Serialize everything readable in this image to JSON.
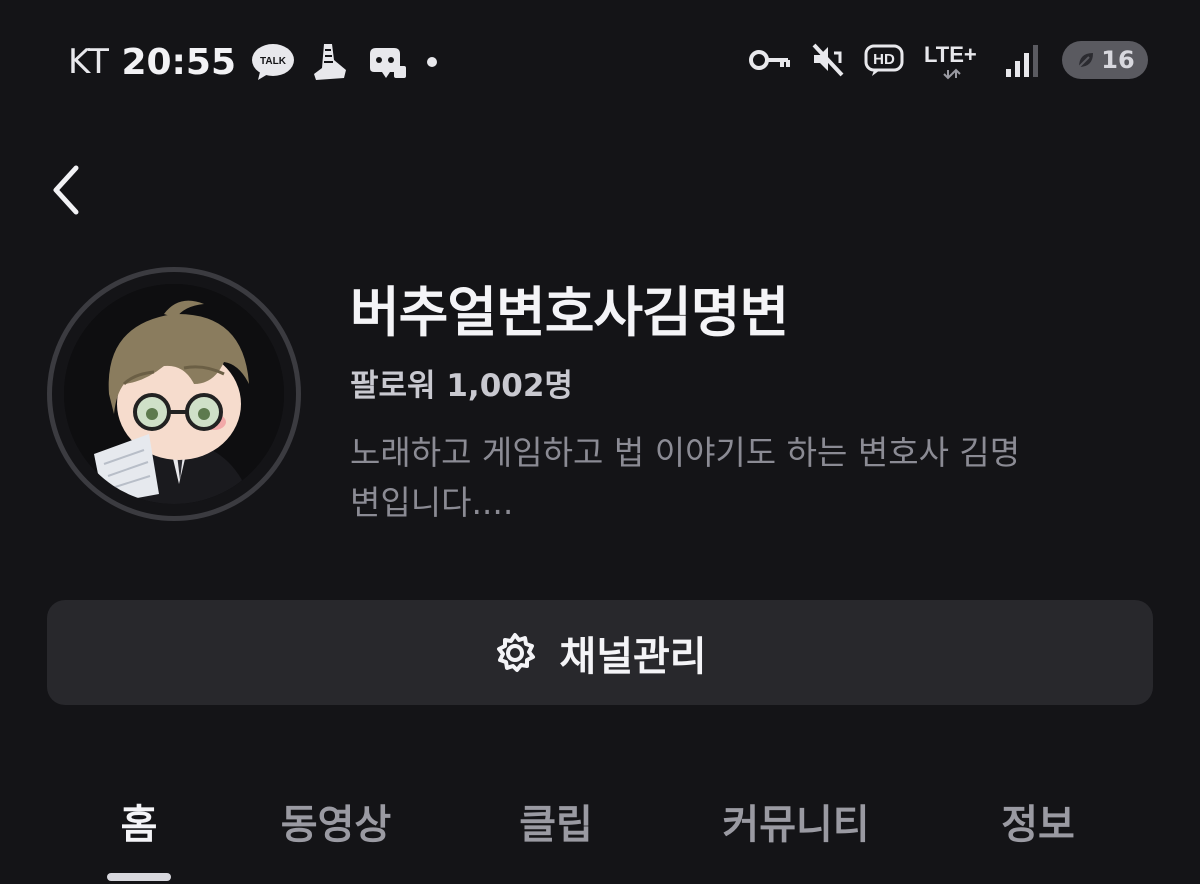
{
  "status_bar": {
    "carrier": "KT",
    "time": "20:55",
    "left_icons": [
      "kakaotalk-icon",
      "shoe-app-icon",
      "game-app-icon",
      "dot-icon"
    ],
    "kakaotalk_label": "TALK",
    "right_icons": [
      "vpn-key-icon",
      "mute-icon",
      "hd-icon",
      "lte-icon",
      "signal-icon",
      "battery-icon"
    ],
    "hd_label": "HD",
    "network_label": "LTE+",
    "battery_level": "16"
  },
  "header": {
    "back_icon": "chevron-left-icon"
  },
  "channel": {
    "name": "버추얼변호사김명변",
    "followers": "팔로워 1,002명",
    "description": "노래하고 게임하고 법 이야기도 하는 변호사 김명변입니다...."
  },
  "manage_button": {
    "icon": "gear-icon",
    "label": "채널관리"
  },
  "tabs": [
    {
      "label": "홈",
      "active": true
    },
    {
      "label": "동영상",
      "active": false
    },
    {
      "label": "클립",
      "active": false
    },
    {
      "label": "커뮤니티",
      "active": false
    },
    {
      "label": "정보",
      "active": false
    }
  ],
  "colors": {
    "background": "#141417",
    "card": "#28282c",
    "text_primary": "#f4f4f7",
    "text_secondary": "#8b8b94"
  }
}
